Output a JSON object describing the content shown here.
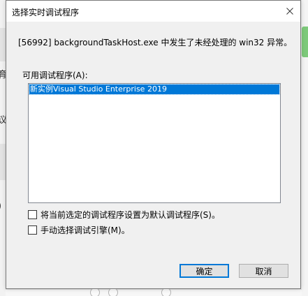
{
  "dialog": {
    "title": "选择实时调试程序",
    "message": "[56992] backgroundTaskHost.exe 中发生了未经处理的 win32 异常。",
    "list_label": "可用调试程序(A):",
    "debuggers": [
      {
        "label": "新实例Visual Studio Enterprise 2019",
        "selected": true
      }
    ],
    "checkbox_set_default": {
      "label": "将当前选定的调试程序设置为默认调试程序(S)。",
      "checked": false
    },
    "checkbox_manual": {
      "label": "手动选择调试引擎(M)。",
      "checked": false
    },
    "ok_label": "确定",
    "cancel_label": "取消",
    "close_icon": "close-icon"
  },
  "background": {
    "left_glyphs": [
      "育",
      "议",
      "F",
      ")"
    ]
  },
  "colors": {
    "selection": "#0078d7",
    "dialog_body": "#f0f0f0",
    "title_bar": "#ffffff",
    "button_face": "#e1e1e1",
    "default_button_border": "#0078d7",
    "background_accent": "#7dc97a"
  }
}
